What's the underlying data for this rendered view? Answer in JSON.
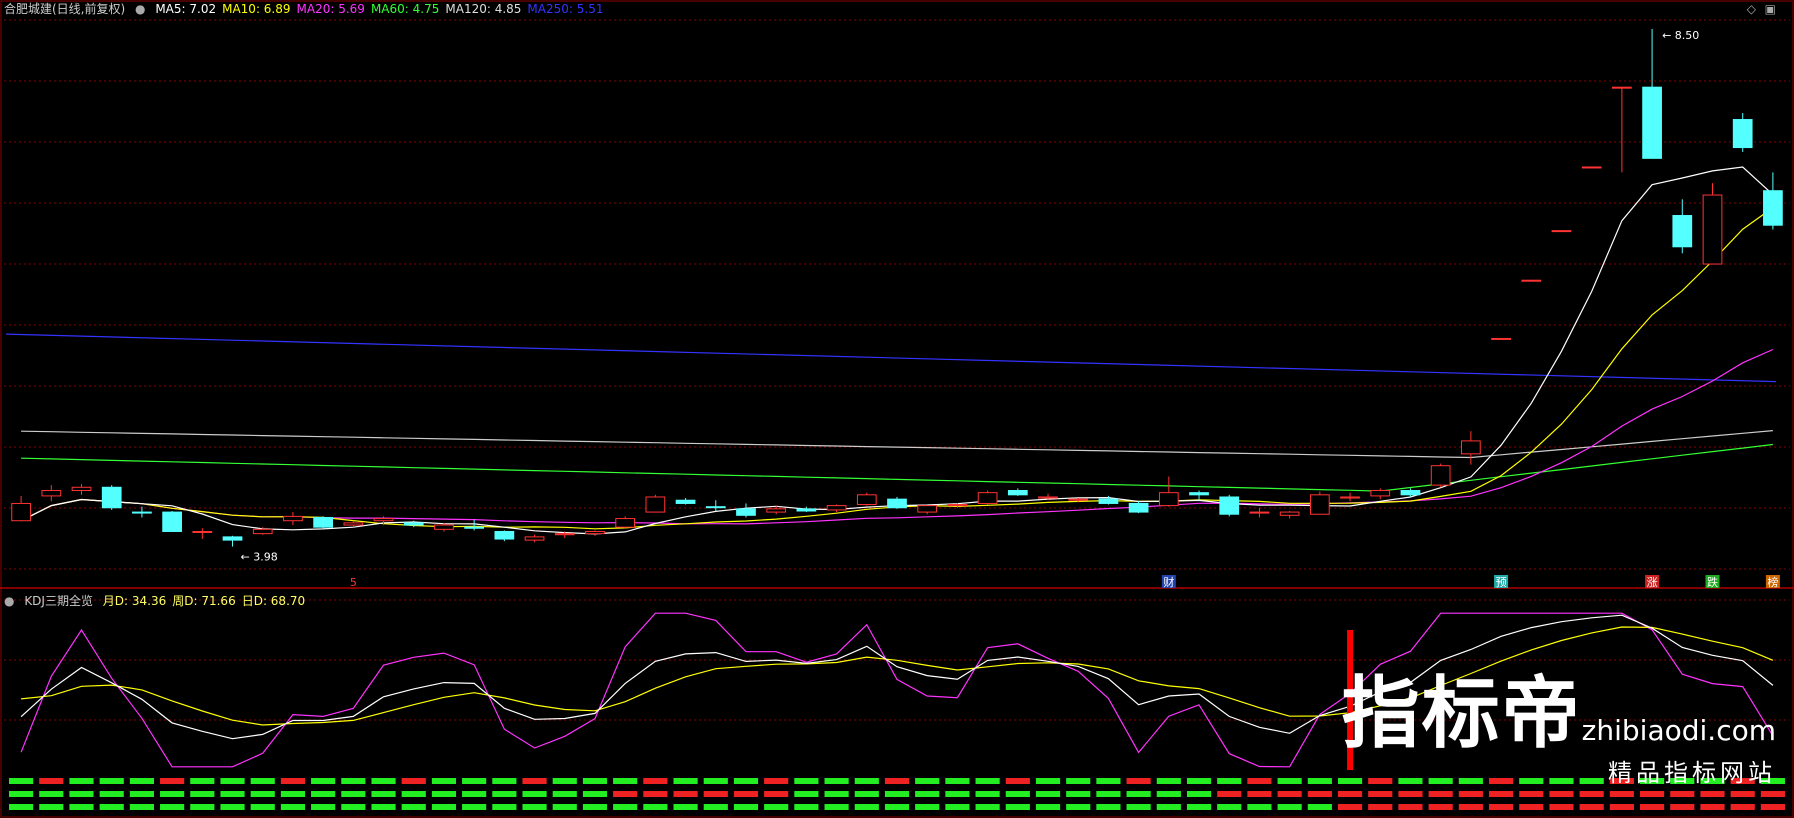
{
  "header": {
    "title": "合肥城建(日线,前复权)",
    "ma": [
      {
        "label": "MA5: 7.02",
        "color": "#ffffff"
      },
      {
        "label": "MA10: 6.89",
        "color": "#ffff00"
      },
      {
        "label": "MA20: 5.69",
        "color": "#ff33ff"
      },
      {
        "label": "MA60: 4.75",
        "color": "#33ff33"
      },
      {
        "label": "MA120: 4.85",
        "color": "#dddddd"
      },
      {
        "label": "MA250: 5.51",
        "color": "#3333ff"
      }
    ]
  },
  "price_panel": {
    "high_label": "8.50",
    "low_label": "3.98",
    "event_markers": [
      {
        "text": "5",
        "color": "#ff3333",
        "bg": ""
      },
      {
        "text": "财",
        "color": "#ffffff",
        "bg": "#2244aa"
      },
      {
        "text": "预",
        "color": "#ffffff",
        "bg": "#22aaaa"
      },
      {
        "text": "涨",
        "color": "#ffffff",
        "bg": "#cc2222"
      },
      {
        "text": "跌",
        "color": "#ffffff",
        "bg": "#22aa22"
      },
      {
        "text": "榜",
        "color": "#ffffff",
        "bg": "#cc6600"
      }
    ]
  },
  "indicator": {
    "name": "KDJ三期全览",
    "values": [
      {
        "label": "月D: 34.36",
        "color": "#ffff66"
      },
      {
        "label": "周D: 71.66",
        "color": "#ffff66"
      },
      {
        "label": "日D: 68.70",
        "color": "#ffff66"
      }
    ]
  },
  "watermark": {
    "brand": "指标帝",
    "url": "zhibiaodi.com",
    "sub": "精品指标网站"
  },
  "colors": {
    "up": "#ff3333",
    "down": "#54ffff",
    "grid": "#8b0000",
    "ma5": "#ffffff",
    "ma10": "#ffff00",
    "ma20": "#ff33ff",
    "ma60": "#33ff33",
    "ma120": "#cccccc",
    "ma250": "#3333ff",
    "k": "#ffffff",
    "d": "#ffff00",
    "j": "#ff33ff"
  },
  "chart_data": {
    "type": "candlestick",
    "price_range": [
      3.8,
      8.9
    ],
    "candles": [
      {
        "o": 4.38,
        "h": 4.45,
        "l": 4.22,
        "c": 4.22,
        "up": true
      },
      {
        "o": 4.45,
        "h": 4.55,
        "l": 4.4,
        "c": 4.5,
        "up": true
      },
      {
        "o": 4.5,
        "h": 4.56,
        "l": 4.46,
        "c": 4.53,
        "up": true
      },
      {
        "o": 4.53,
        "h": 4.55,
        "l": 4.32,
        "c": 4.34,
        "up": false
      },
      {
        "o": 4.3,
        "h": 4.35,
        "l": 4.25,
        "c": 4.3,
        "up": false
      },
      {
        "o": 4.3,
        "h": 4.31,
        "l": 4.12,
        "c": 4.12,
        "up": false
      },
      {
        "o": 4.12,
        "h": 4.15,
        "l": 4.05,
        "c": 4.12,
        "up": true
      },
      {
        "o": 4.07,
        "h": 4.08,
        "l": 3.98,
        "c": 4.04,
        "up": false
      },
      {
        "o": 4.1,
        "h": 4.16,
        "l": 4.09,
        "c": 4.14,
        "up": true
      },
      {
        "o": 4.22,
        "h": 4.3,
        "l": 4.18,
        "c": 4.26,
        "up": true
      },
      {
        "o": 4.25,
        "h": 4.26,
        "l": 4.15,
        "c": 4.16,
        "up": false
      },
      {
        "o": 4.18,
        "h": 4.22,
        "l": 4.16,
        "c": 4.2,
        "up": true
      },
      {
        "o": 4.22,
        "h": 4.26,
        "l": 4.18,
        "c": 4.24,
        "up": true
      },
      {
        "o": 4.2,
        "h": 4.22,
        "l": 4.16,
        "c": 4.18,
        "up": false
      },
      {
        "o": 4.14,
        "h": 4.2,
        "l": 4.12,
        "c": 4.18,
        "up": true
      },
      {
        "o": 4.16,
        "h": 4.23,
        "l": 4.13,
        "c": 4.15,
        "up": false
      },
      {
        "o": 4.12,
        "h": 4.13,
        "l": 4.03,
        "c": 4.05,
        "up": false
      },
      {
        "o": 4.04,
        "h": 4.09,
        "l": 4.02,
        "c": 4.07,
        "up": true
      },
      {
        "o": 4.09,
        "h": 4.12,
        "l": 4.06,
        "c": 4.1,
        "up": true
      },
      {
        "o": 4.1,
        "h": 4.13,
        "l": 4.08,
        "c": 4.12,
        "up": true
      },
      {
        "o": 4.16,
        "h": 4.26,
        "l": 4.15,
        "c": 4.24,
        "up": true
      },
      {
        "o": 4.3,
        "h": 4.46,
        "l": 4.3,
        "c": 4.44,
        "up": true
      },
      {
        "o": 4.41,
        "h": 4.43,
        "l": 4.37,
        "c": 4.38,
        "up": false
      },
      {
        "o": 4.35,
        "h": 4.41,
        "l": 4.31,
        "c": 4.35,
        "up": false
      },
      {
        "o": 4.33,
        "h": 4.38,
        "l": 4.25,
        "c": 4.27,
        "up": false
      },
      {
        "o": 4.3,
        "h": 4.36,
        "l": 4.28,
        "c": 4.33,
        "up": true
      },
      {
        "o": 4.33,
        "h": 4.35,
        "l": 4.3,
        "c": 4.31,
        "up": false
      },
      {
        "o": 4.32,
        "h": 4.37,
        "l": 4.3,
        "c": 4.36,
        "up": true
      },
      {
        "o": 4.37,
        "h": 4.48,
        "l": 4.36,
        "c": 4.46,
        "up": true
      },
      {
        "o": 4.42,
        "h": 4.44,
        "l": 4.33,
        "c": 4.34,
        "up": false
      },
      {
        "o": 4.3,
        "h": 4.36,
        "l": 4.28,
        "c": 4.36,
        "up": true
      },
      {
        "o": 4.36,
        "h": 4.38,
        "l": 4.34,
        "c": 4.37,
        "up": true
      },
      {
        "o": 4.38,
        "h": 4.5,
        "l": 4.37,
        "c": 4.48,
        "up": true
      },
      {
        "o": 4.5,
        "h": 4.52,
        "l": 4.45,
        "c": 4.46,
        "up": false
      },
      {
        "o": 4.44,
        "h": 4.47,
        "l": 4.41,
        "c": 4.43,
        "up": true
      },
      {
        "o": 4.41,
        "h": 4.43,
        "l": 4.39,
        "c": 4.42,
        "up": true
      },
      {
        "o": 4.42,
        "h": 4.45,
        "l": 4.37,
        "c": 4.38,
        "up": false
      },
      {
        "o": 4.38,
        "h": 4.4,
        "l": 4.29,
        "c": 4.3,
        "up": false
      },
      {
        "o": 4.36,
        "h": 4.63,
        "l": 4.35,
        "c": 4.48,
        "up": true
      },
      {
        "o": 4.48,
        "h": 4.5,
        "l": 4.41,
        "c": 4.46,
        "up": false
      },
      {
        "o": 4.44,
        "h": 4.46,
        "l": 4.26,
        "c": 4.28,
        "up": false
      },
      {
        "o": 4.3,
        "h": 4.34,
        "l": 4.25,
        "c": 4.3,
        "up": true
      },
      {
        "o": 4.27,
        "h": 4.31,
        "l": 4.24,
        "c": 4.3,
        "up": true
      },
      {
        "o": 4.28,
        "h": 4.49,
        "l": 4.28,
        "c": 4.46,
        "up": true
      },
      {
        "o": 4.43,
        "h": 4.48,
        "l": 4.4,
        "c": 4.44,
        "up": true
      },
      {
        "o": 4.45,
        "h": 4.52,
        "l": 4.42,
        "c": 4.5,
        "up": true
      },
      {
        "o": 4.46,
        "h": 4.52,
        "l": 4.44,
        "c": 4.5,
        "up": false
      },
      {
        "o": 4.55,
        "h": 4.75,
        "l": 4.53,
        "c": 4.73,
        "up": true
      },
      {
        "o": 4.84,
        "h": 5.05,
        "l": 4.74,
        "c": 4.96,
        "up": true
      },
      {
        "o": 5.91,
        "h": 5.91,
        "l": 5.91,
        "c": 5.91,
        "up": true
      },
      {
        "o": 6.45,
        "h": 6.45,
        "l": 6.45,
        "c": 6.45,
        "up": true
      },
      {
        "o": 6.91,
        "h": 6.91,
        "l": 6.91,
        "c": 6.91,
        "up": true
      },
      {
        "o": 7.5,
        "h": 7.5,
        "l": 7.5,
        "c": 7.5,
        "up": true
      },
      {
        "o": 8.24,
        "h": 8.24,
        "l": 7.45,
        "c": 8.24,
        "up": true
      },
      {
        "o": 8.24,
        "h": 8.78,
        "l": 7.58,
        "c": 7.58,
        "up": false
      },
      {
        "o": 7.05,
        "h": 7.2,
        "l": 6.7,
        "c": 6.76,
        "up": false
      },
      {
        "o": 6.6,
        "h": 7.35,
        "l": 6.6,
        "c": 7.24,
        "up": true
      },
      {
        "o": 7.94,
        "h": 8.0,
        "l": 7.64,
        "c": 7.68,
        "up": false
      },
      {
        "o": 7.28,
        "h": 7.45,
        "l": 6.92,
        "c": 6.96,
        "up": false
      }
    ]
  }
}
